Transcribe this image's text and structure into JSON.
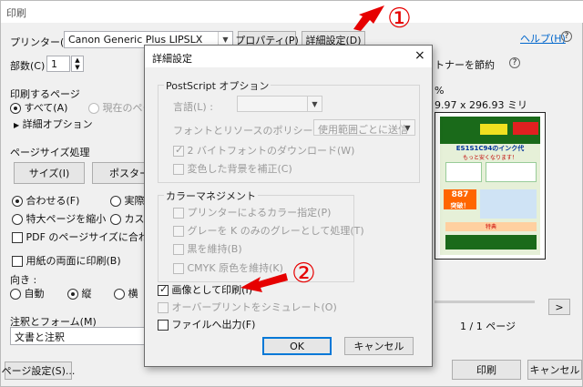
{
  "window": {
    "title": "印刷"
  },
  "header": {
    "printer_label": "プリンター(N) :",
    "printer_value": "Canon Generic Plus LIPSLX",
    "properties_btn": "プロパティ(P)",
    "advanced_btn": "詳細設定(D)",
    "help_link": "ヘルプ(H)",
    "copies_label": "部数(C) :",
    "copies_value": "1",
    "toner_saving_label": "トナーを節約"
  },
  "pages": {
    "section_label": "印刷するページ",
    "all_option": "すべて(A)",
    "current_option": "現在のペー",
    "more_options": "詳細オプション"
  },
  "sizing": {
    "section_label": "ページサイズ処理",
    "size_btn": "サイズ(I)",
    "poster_btn": "ポスター",
    "fit_option": "合わせる(F)",
    "actual_option": "実際",
    "shrink_option": "特大ページを縮小",
    "custom_option": "カスタ",
    "pdf_page_size_option": "PDF のページサイズに合わせて用",
    "duplex_option": "用紙の両面に印刷(B)"
  },
  "orientation": {
    "label": "向き :",
    "auto": "自動",
    "portrait": "縦",
    "landscape": "横"
  },
  "comments": {
    "label": "注釈とフォーム(M)",
    "value": "文書と注釈"
  },
  "preview": {
    "dimensions": "9.97 x 296.93 ミリ",
    "percent": "%",
    "page_count": "1 / 1 ページ",
    "next_btn": ">",
    "flyer_title": "ES1S1C94のインク代",
    "flyer_sub": "もっと安くなります！",
    "flyer_badge": "887",
    "flyer_break": "突破！",
    "flyer_special": "特典"
  },
  "bottom": {
    "page_setup_btn": "ページ設定(S)...",
    "print_btn": "印刷",
    "cancel_btn": "キャンセル"
  },
  "dialog": {
    "title": "詳細設定",
    "close": "×",
    "postscript_group": "PostScript オプション",
    "language_label": "言語(L) :",
    "font_policy_label": "フォントとリソースのポリシー(N) :",
    "font_policy_value": "使用範囲ごとに送信",
    "download_2byte": "2 バイトフォントのダウンロード(W)",
    "correct_bg": "変色した背景を補正(C)",
    "color_group": "カラーマネジメント",
    "printer_color": "プリンターによるカラー指定(P)",
    "gray_k": "グレーを K のみのグレーとして処理(T)",
    "keep_black": "黒を維持(B)",
    "keep_cmyk": "CMYK 原色を維持(K)",
    "print_as_image": "画像として印刷(I)",
    "simulate_overprint": "オーバープリントをシミュレート(O)",
    "print_to_file": "ファイルへ出力(F)",
    "ok_btn": "OK",
    "cancel_btn": "キャンセル"
  },
  "annotations": {
    "marker_1": "①",
    "marker_2": "②"
  },
  "colors": {
    "accent_red": "#e60000",
    "link_blue": "#0066cc"
  }
}
